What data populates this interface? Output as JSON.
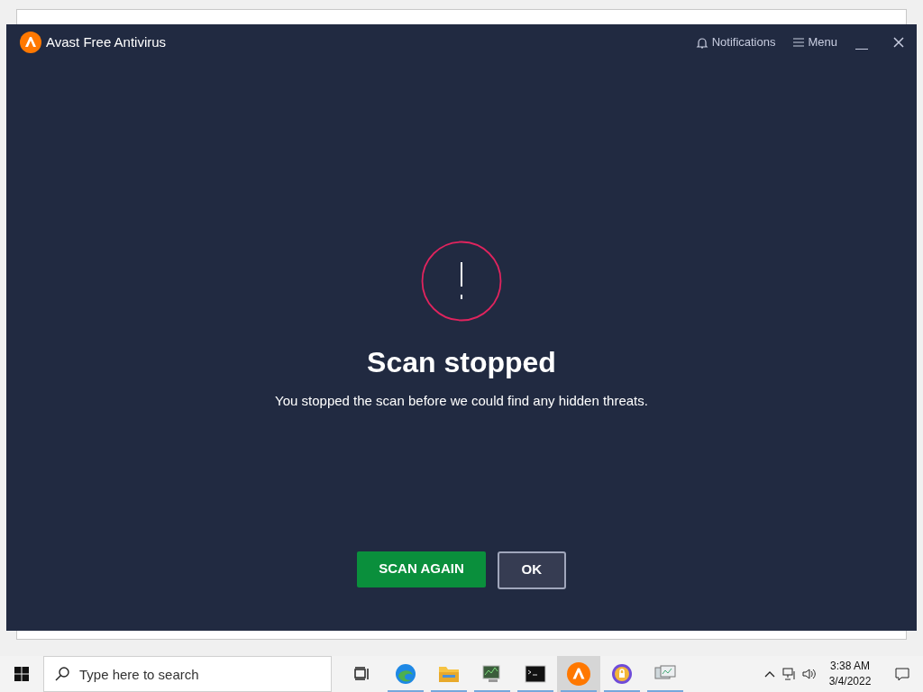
{
  "window": {
    "title": "Avast Free Antivirus",
    "header_links": [
      {
        "kind": "notifications",
        "label": "Notifications"
      },
      {
        "kind": "menu",
        "label": "Menu"
      }
    ]
  },
  "result": {
    "title": "Scan stopped",
    "message": "You stopped the scan before we could find any hidden threats."
  },
  "buttons": [
    {
      "kind": "primary",
      "label": "SCAN AGAIN"
    },
    {
      "kind": "secondary",
      "label": "OK"
    }
  ],
  "taskbar": {
    "search": {
      "placeholder": "Type here to search"
    },
    "apps": [
      {
        "kind": "taskview",
        "running": false,
        "selected": false
      },
      {
        "kind": "browser",
        "running": true,
        "selected": false
      },
      {
        "kind": "folder",
        "running": true,
        "selected": false
      },
      {
        "kind": "monitor",
        "running": true,
        "selected": false
      },
      {
        "kind": "terminal",
        "running": true,
        "selected": false
      },
      {
        "kind": "avast",
        "running": true,
        "selected": true
      },
      {
        "kind": "vpn",
        "running": true,
        "selected": false
      },
      {
        "kind": "remote",
        "running": true,
        "selected": false
      }
    ],
    "time": "3:38 AM",
    "date": "3/4/2022"
  }
}
